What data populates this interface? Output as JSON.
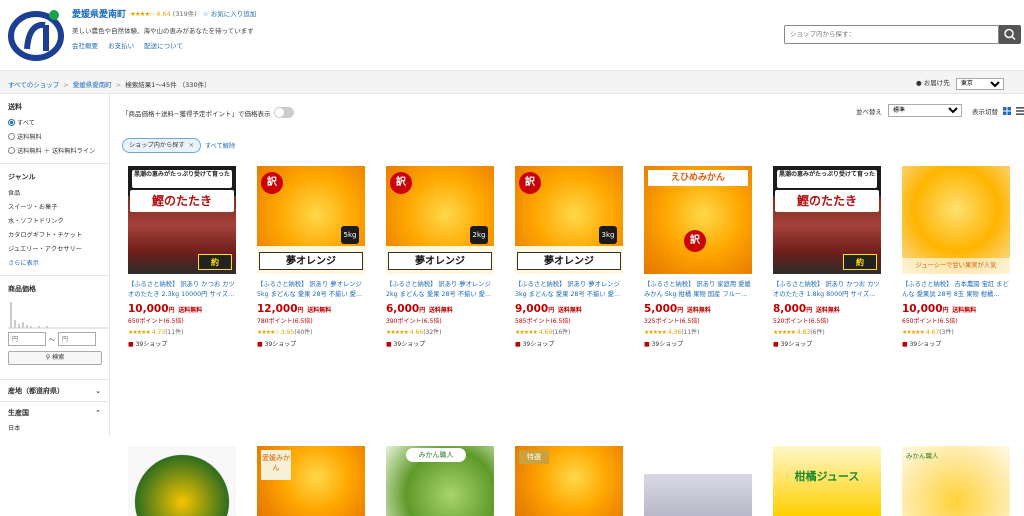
{
  "shop": {
    "name": "愛媛県愛南町",
    "stars": "★★★★☆",
    "rating": "4.64",
    "review_count": "(319件)",
    "favorite": "☆ お気に入り追加",
    "tagline": "美しい農色や自然体験、海や山の恵みがあなたを待っています",
    "links": [
      "会社概要",
      "お支払い",
      "配送について"
    ]
  },
  "search": {
    "placeholder": "ショップ内から探す："
  },
  "breadcrumb": {
    "items": [
      "すべてのショップ",
      "愛媛県愛南町"
    ],
    "result": "検索結果1〜45件 （330件）"
  },
  "delivery": {
    "label": "お届け先",
    "value": "東京"
  },
  "sidebar": {
    "shipping_head": "送料",
    "shipping_options": [
      "すべて",
      "送料無料",
      "送料無料 ＋ 送料無料ライン"
    ],
    "genre_head": "ジャンル",
    "genres": [
      "食品",
      "スイーツ・お菓子",
      "水・ソフトドリンク",
      "カタログギフト・チケット",
      "ジュエリー・アクセサリー",
      "さらに表示"
    ],
    "price_head": "商品価格",
    "price_min_placeholder": "円",
    "price_max_placeholder": "円",
    "price_sep": "〜",
    "price_search": "検索",
    "region_head": "産地（都道府県）",
    "country_head": "生産国",
    "country_first": "日本"
  },
  "toolbar": {
    "price_toggle_label": "「商品価格＋送料−獲得予定ポイント」で価格表示",
    "sort_label": "並べ替え",
    "sort_value": "標準",
    "view_label": "表示切替"
  },
  "filter": {
    "chip": "ショップ内から探す",
    "clear_all": "すべて解除"
  },
  "products": [
    {
      "title": "【ふるさと納税】 訳あり かつお カツオのたたき 2.3kg 10000円 サイズ…",
      "price": "10,000",
      "yen": "円",
      "shipping": "送料無料",
      "points": "650ポイント(6.5倍)",
      "stars": "★★★★★",
      "score": "4.73",
      "reviews": "(11件)",
      "shop": "39ショップ",
      "img": {
        "top": "黒潮の恵みがたっぷり受けて育った",
        "main": "鰹のたたき",
        "weight": "約2.3kg"
      }
    },
    {
      "title": "【ふるさと納税】 訳あり 夢オレンジ 5kg まどんな 愛果 28号 不揃い 愛…",
      "price": "12,000",
      "yen": "円",
      "shipping": "送料無料",
      "points": "780ポイント(6.5倍)",
      "stars": "★★★★☆",
      "score": "3.95",
      "reviews": "(40件)",
      "shop": "39ショップ",
      "img": {
        "wake": "訳",
        "kg": "5kg",
        "main": "夢オレンジ"
      }
    },
    {
      "title": "【ふるさと納税】 訳あり 夢オレンジ 2kg まどんな 愛果 28号 不揃い 愛…",
      "price": "6,000",
      "yen": "円",
      "shipping": "送料無料",
      "points": "390ポイント(6.5倍)",
      "stars": "★★★★★",
      "score": "4.66",
      "reviews": "(32件)",
      "shop": "39ショップ",
      "img": {
        "wake": "訳",
        "kg": "2kg",
        "main": "夢オレンジ"
      }
    },
    {
      "title": "【ふるさと納税】 訳あり 夢オレンジ 3kg まどんな 愛果 28号 不揃い 愛…",
      "price": "9,000",
      "yen": "円",
      "shipping": "送料無料",
      "points": "585ポイント(6.5倍)",
      "stars": "★★★★★",
      "score": "4.69",
      "reviews": "(16件)",
      "shop": "39ショップ",
      "img": {
        "wake": "訳",
        "kg": "3kg",
        "main": "夢オレンジ"
      }
    },
    {
      "title": "【ふるさと納税】 訳あり 家庭用 愛媛みかん 5kg 柑橘 果物 国産 フルー…",
      "price": "5,000",
      "yen": "円",
      "shipping": "送料無料",
      "points": "325ポイント(6.5倍)",
      "stars": "★★★★★",
      "score": "4.36",
      "reviews": "(11件)",
      "shop": "39ショップ",
      "img": {
        "label": "えひめみかん",
        "wake": "訳"
      }
    },
    {
      "title": "【ふるさと納税】 訳あり かつお カツオのたたき 1.8kg 8000円 サイズ…",
      "price": "8,000",
      "yen": "円",
      "shipping": "送料無料",
      "points": "520ポイント(6.5倍)",
      "stars": "★★★★★",
      "score": "4.83",
      "reviews": "(6件)",
      "shop": "39ショップ",
      "img": {
        "top": "黒潮の恵みがたっぷり受けて育った",
        "main": "鰹のたたき",
        "weight": "約1.8kg"
      }
    },
    {
      "title": "【ふるさと納税】 吉本農園 宝紅 まどんな 愛果試 28号 8玉 果物 柑橘…",
      "price": "10,000",
      "yen": "円",
      "shipping": "送料無料",
      "points": "650ポイント(6.5倍)",
      "stars": "★★★★★",
      "score": "4.67",
      "reviews": "(3件)",
      "shop": "39ショップ",
      "img": {
        "caption": "ジューシーで甘い果実が人気"
      }
    }
  ],
  "row2": [
    {
      "label": ""
    },
    {
      "label": "愛媛みかん"
    },
    {
      "label": "みかん職人"
    },
    {
      "label": "特選"
    },
    {
      "label": ""
    },
    {
      "label": "柑橘ジュース"
    },
    {
      "label": "みかん職人"
    }
  ]
}
